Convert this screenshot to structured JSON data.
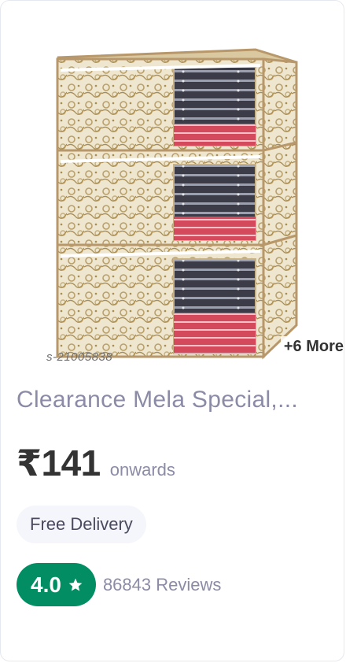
{
  "product": {
    "sku": "s-21005838",
    "more_images_label": "+6 More",
    "title": "Clearance Mela Special,...",
    "price": "₹141",
    "price_suffix": "onwards",
    "delivery_label": "Free Delivery",
    "rating": "4.0",
    "reviews_label": "86843 Reviews",
    "image_icon": "storage-bags-image",
    "rating_icon": "star-icon"
  },
  "colors": {
    "rating_badge": "#038d63",
    "title_text": "#8b8ba7",
    "price_text": "#333333",
    "delivery_bg": "#f4f6fb"
  }
}
